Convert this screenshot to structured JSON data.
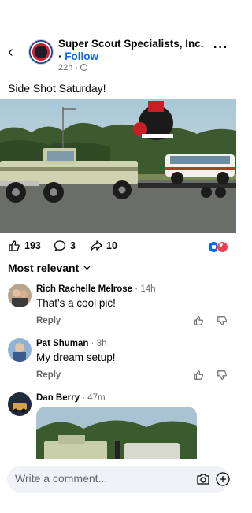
{
  "post": {
    "page_name": "Super Scout Specialists, Inc.",
    "follow_label": "Follow",
    "separator": "·",
    "time": "22h",
    "caption": "Side Shot Saturday!"
  },
  "stats": {
    "likes": "193",
    "comments": "3",
    "shares": "10"
  },
  "sort_label": "Most relevant",
  "comments": [
    {
      "name": "Rich Rachelle Melrose",
      "age": "14h",
      "text": "That's a cool pic!",
      "reply": "Reply"
    },
    {
      "name": "Pat Shuman",
      "age": "8h",
      "text": "My dream setup!",
      "reply": "Reply"
    },
    {
      "name": "Dan Berry",
      "age": "47m"
    }
  ],
  "composer": {
    "placeholder": "Write a comment..."
  },
  "colors": {
    "accent": "#0866ff",
    "muted": "#65676b",
    "love": "#f33e58"
  }
}
